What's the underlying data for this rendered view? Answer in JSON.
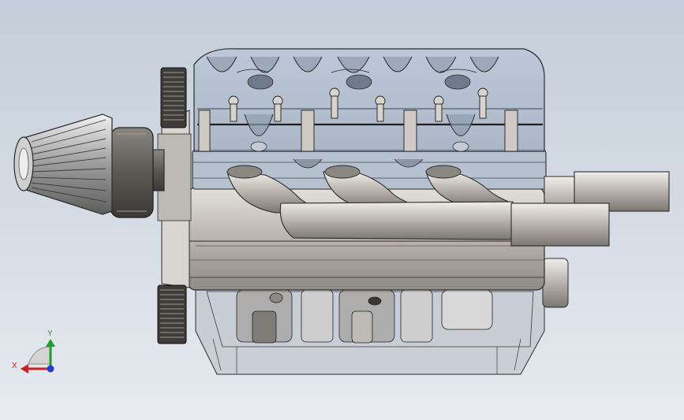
{
  "viewport": {
    "background_top": "#c4cdd9",
    "background_bottom": "#e7ebf0"
  },
  "model": {
    "subject": "v-engine-assembly",
    "body_color": "#c9c4bd",
    "transparent_cover_color": "#a9b8cc",
    "edge_color": "#2b2b2b"
  },
  "triad": {
    "x_label": "X",
    "y_label": "Y",
    "x_color": "#cc1f1f",
    "y_color": "#1f9d2a",
    "z_color": "#1f3fcc"
  }
}
